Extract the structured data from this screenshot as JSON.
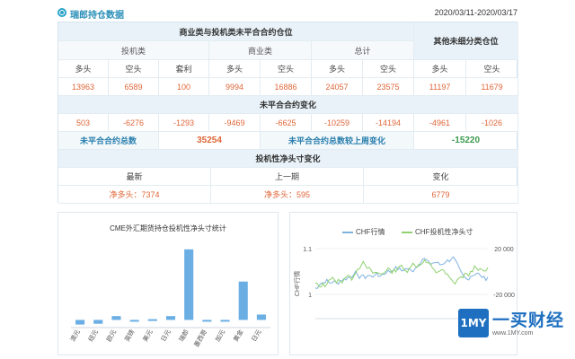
{
  "header": {
    "title": "瑞郎持仓数据",
    "date_range": "2020/03/11-2020/03/17"
  },
  "table": {
    "group_commercial_spec": "商业类与投机类未平合合约仓位",
    "group_other": "其他未细分类仓位",
    "sub_spec": "投机类",
    "sub_commercial": "商业类",
    "sub_total": "总计",
    "col_long": "多头",
    "col_short": "空头",
    "col_spread": "套利",
    "values": {
      "spec_long": "13963",
      "spec_short": "6589",
      "spec_spread": "100",
      "comm_long": "9994",
      "comm_short": "16886",
      "total_long": "24057",
      "total_short": "23575",
      "other_long": "11197",
      "other_short": "11679"
    },
    "change_title": "未平合合约变化",
    "changes": [
      "503",
      "-6276",
      "-1293",
      "-9469",
      "-6625",
      "-10259",
      "-14194",
      "-4961",
      "-1026"
    ],
    "oi_total_label": "未平合合约总数",
    "oi_total_value": "35254",
    "oi_change_label": "未平合合约总数较上周变化",
    "oi_change_value": "-15220",
    "net_title": "投机性净头寸变化",
    "net_latest_label": "最新",
    "net_prev_label": "上一期",
    "net_change_label": "变化",
    "net_latest_value": "净多头：7374",
    "net_prev_value": "净多头：595",
    "net_change_value": "6779"
  },
  "chart_data": [
    {
      "type": "bar",
      "title": "CME外汇期货持仓投机性净头寸统计",
      "categories": [
        "澳元",
        "纽元",
        "欧元",
        "英镑",
        "美元",
        "日元",
        "瑞郎",
        "墨西哥",
        "加元",
        "黄金",
        "日元"
      ],
      "values": [
        -3000,
        -2500,
        2500,
        -500,
        500,
        2500,
        46000,
        -500,
        -500,
        25000,
        3500
      ],
      "ylim": [
        -5000,
        50000
      ],
      "color": "#6aaee3"
    },
    {
      "type": "line",
      "series": [
        {
          "name": "CHF行情",
          "color": "#7fb2df"
        },
        {
          "name": "CHF投机性净头寸",
          "color": "#8fd16f"
        }
      ],
      "y_left_label": "CHF行情",
      "y_left_ticks": [
        "1.1",
        "1"
      ],
      "y_right_ticks": [
        "20 000",
        "-20 000"
      ]
    }
  ],
  "logo": {
    "mark": "1MY",
    "name": "一买财经",
    "url": "www.1MY.com"
  }
}
